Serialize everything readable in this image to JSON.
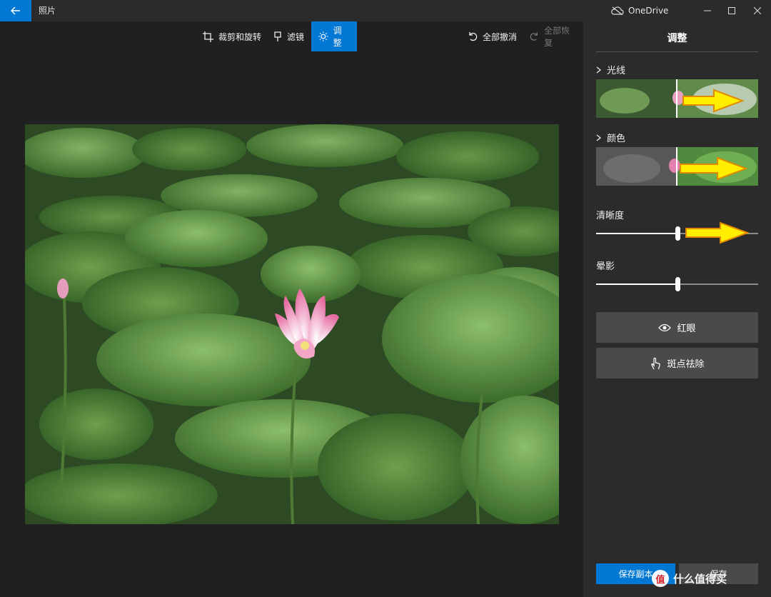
{
  "titlebar": {
    "app_title": "照片",
    "onedrive_label": "OneDrive",
    "minimize_icon": "minimize-icon",
    "maximize_icon": "maximize-icon",
    "close_icon": "close-icon",
    "accent": "#0078d4"
  },
  "toolbar": {
    "crop_label": "裁剪和旋转",
    "filter_label": "滤镜",
    "adjust_label": "调整",
    "undo_all_label": "全部撤消",
    "redo_all_label": "全部恢复"
  },
  "panel": {
    "title": "调整",
    "light_label": "光线",
    "color_label": "颜色",
    "clarity_label": "清晰度",
    "clarity_value": 0.5,
    "vignette_label": "晕影",
    "vignette_value": 0.5,
    "red_eye_label": "红眼",
    "spot_fix_label": "斑点祛除",
    "save_copy_label": "保存副本",
    "save_label": "保存"
  },
  "watermark": {
    "text": "值 什么值得买"
  }
}
